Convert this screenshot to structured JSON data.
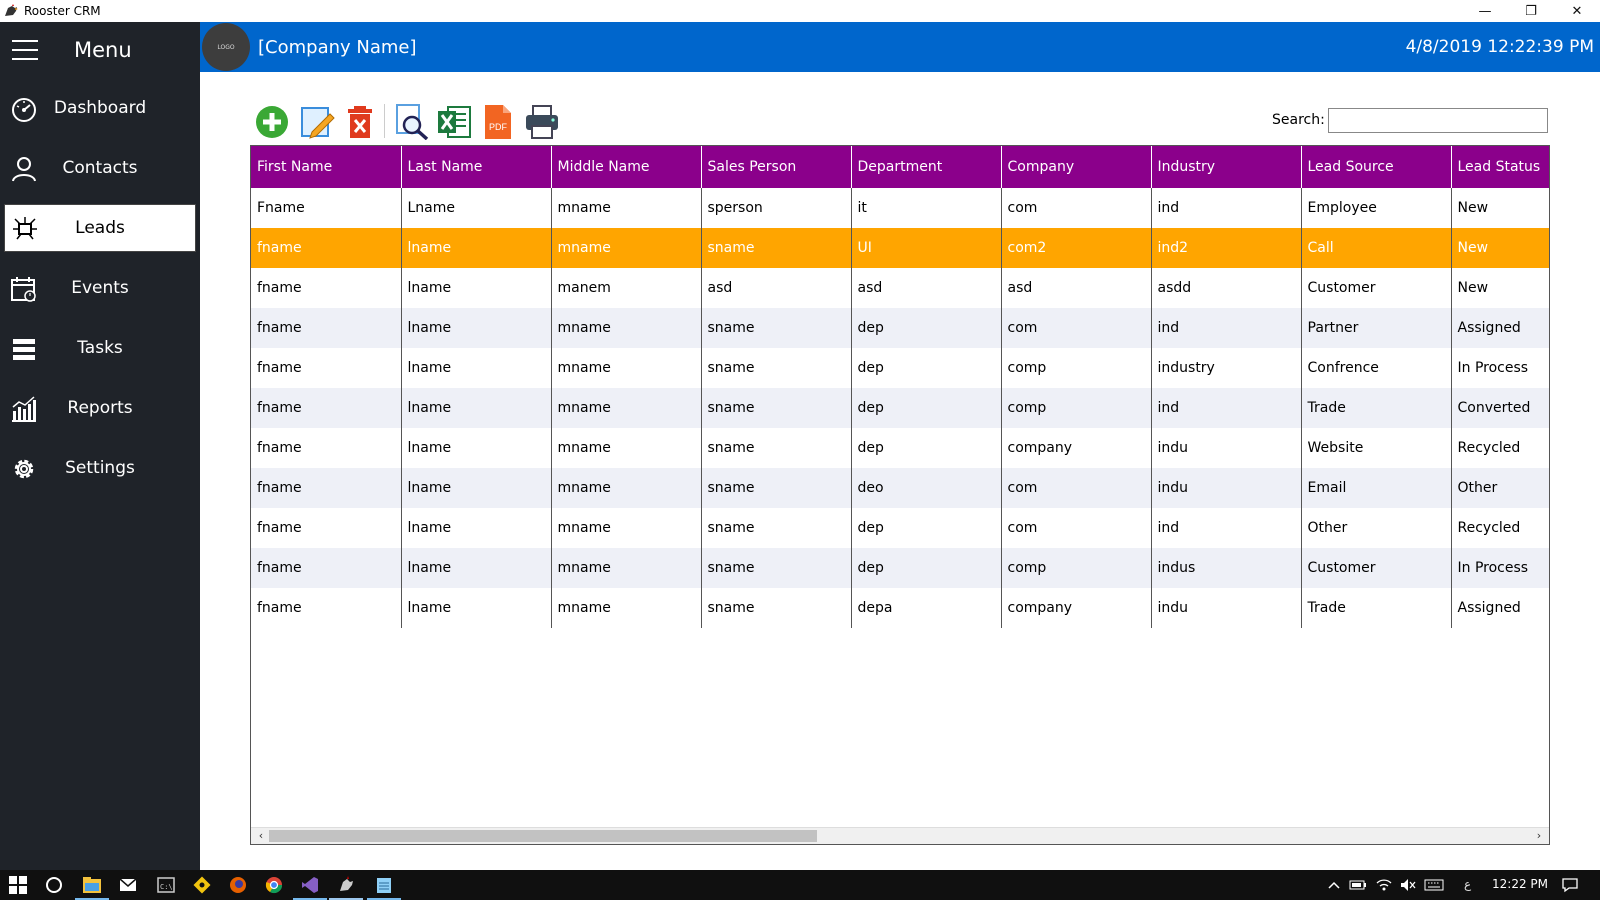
{
  "window": {
    "title": "Rooster CRM",
    "minimize_glyph": "—",
    "restore_glyph": "❐",
    "close_glyph": "✕"
  },
  "sidebar": {
    "menu_label": "Menu",
    "items": [
      {
        "label": "Dashboard",
        "icon": "gauge-icon"
      },
      {
        "label": "Contacts",
        "icon": "person-icon"
      },
      {
        "label": "Leads",
        "icon": "leads-network-icon",
        "active": true
      },
      {
        "label": "Events",
        "icon": "calendar-icon"
      },
      {
        "label": "Tasks",
        "icon": "tasks-list-icon"
      },
      {
        "label": "Reports",
        "icon": "bar-chart-icon"
      },
      {
        "label": "Settings",
        "icon": "gear-icon"
      }
    ]
  },
  "header": {
    "logo_text": "LOGO",
    "company_name": "[Company Name]",
    "datetime": "4/8/2019 12:22:39 PM"
  },
  "toolbar": {
    "buttons": [
      "add-icon",
      "edit-icon",
      "delete-icon",
      "preview-icon",
      "excel-icon",
      "pdf-icon",
      "print-icon"
    ],
    "pdf_label": "PDF",
    "search_label": "Search:",
    "search_value": ""
  },
  "grid": {
    "columns": [
      "First Name",
      "Last Name",
      "Middle Name",
      "Sales Person",
      "Department",
      "Company",
      "Industry",
      "Lead Source",
      "Lead Status"
    ],
    "rows": [
      [
        "Fname",
        "Lname",
        "mname",
        "sperson",
        "it",
        "com",
        "ind",
        "Employee",
        "New"
      ],
      [
        "fname",
        "lname",
        "mname",
        "sname",
        "UI",
        "com2",
        "ind2",
        "Call",
        "New"
      ],
      [
        "fname",
        "lname",
        "manem",
        "asd",
        "asd",
        "asd",
        "asdd",
        "Customer",
        "New"
      ],
      [
        "fname",
        "lname",
        "mname",
        "sname",
        "dep",
        "com",
        "ind",
        "Partner",
        "Assigned"
      ],
      [
        "fname",
        "lname",
        "mname",
        "sname",
        "dep",
        "comp",
        "industry",
        "Confrence",
        "In Process"
      ],
      [
        "fname",
        "lname",
        "mname",
        "sname",
        "dep",
        "comp",
        "ind",
        "Trade",
        "Converted"
      ],
      [
        "fname",
        "lname",
        "mname",
        "sname",
        "dep",
        "company",
        "indu",
        "Website",
        "Recycled"
      ],
      [
        "fname",
        "lname",
        "mname",
        "sname",
        "deo",
        "com",
        "indu",
        "Email",
        "Other"
      ],
      [
        "fname",
        "lname",
        "mname",
        "sname",
        "dep",
        "com",
        "ind",
        "Other",
        "Recycled"
      ],
      [
        "fname",
        "lname",
        "mname",
        "sname",
        "dep",
        "comp",
        "indus",
        "Customer",
        "In Process"
      ],
      [
        "fname",
        "lname",
        "mname",
        "sname",
        "depa",
        "company",
        "indu",
        "Trade",
        "Assigned"
      ]
    ],
    "selected_row": 1,
    "scroll_left_glyph": "‹",
    "scroll_right_glyph": "›"
  },
  "taskbar": {
    "time": "12:22 PM",
    "input_indicator": "ع",
    "icons": [
      "windows-start-icon",
      "cortana-icon",
      "file-explorer-icon",
      "mail-icon",
      "terminal-icon",
      "git-icon",
      "firefox-icon",
      "chrome-icon",
      "visual-studio-icon",
      "rooster-app-icon",
      "notepad-icon"
    ]
  },
  "colors": {
    "sidebar_bg": "#1f2329",
    "header_bg": "#0066cc",
    "grid_header_bg": "#8b008b",
    "selected_row_bg": "#ffa500",
    "alt_row_bg": "#eef0f7"
  }
}
